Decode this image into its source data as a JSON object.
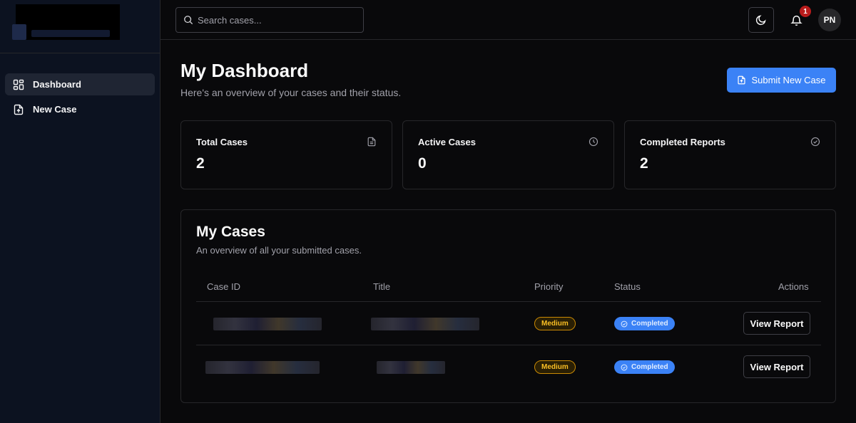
{
  "sidebar": {
    "items": [
      {
        "label": "Dashboard",
        "icon": "dashboard-grid-icon",
        "active": true
      },
      {
        "label": "New Case",
        "icon": "file-upload-icon",
        "active": false
      }
    ]
  },
  "topbar": {
    "search_placeholder": "Search cases...",
    "notification_count": "1",
    "avatar_initials": "PN"
  },
  "header": {
    "title": "My Dashboard",
    "subtitle": "Here's an overview of your cases and their status.",
    "submit_label": "Submit New Case"
  },
  "stats": [
    {
      "label": "Total Cases",
      "value": "2",
      "icon": "document-icon"
    },
    {
      "label": "Active Cases",
      "value": "0",
      "icon": "clock-icon"
    },
    {
      "label": "Completed Reports",
      "value": "2",
      "icon": "check-circle-icon"
    }
  ],
  "cases": {
    "title": "My Cases",
    "subtitle": "An overview of all your submitted cases.",
    "columns": [
      "Case ID",
      "Title",
      "Priority",
      "Status",
      "Actions"
    ],
    "rows": [
      {
        "priority": "Medium",
        "status": "Completed",
        "action": "View Report"
      },
      {
        "priority": "Medium",
        "status": "Completed",
        "action": "View Report"
      }
    ]
  },
  "colors": {
    "accent": "#3b82f6",
    "priority_medium": "#fbbf24",
    "notification": "#b91c1c",
    "background": "#09090b"
  }
}
